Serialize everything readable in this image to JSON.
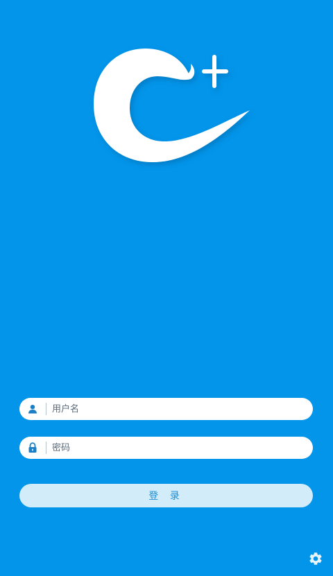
{
  "login": {
    "username_placeholder": "用户名",
    "password_placeholder": "密码",
    "username_value": "",
    "password_value": "",
    "submit_label": "登 录"
  },
  "icons": {
    "logo": "c-plus-logo",
    "username": "user-icon",
    "password": "lock-icon",
    "settings": "gear-icon"
  },
  "colors": {
    "background": "#0295ea",
    "field": "#ffffff",
    "button": "#d2ecfa",
    "button_text": "#1c8fd6",
    "icon": "#1a7fc4"
  }
}
